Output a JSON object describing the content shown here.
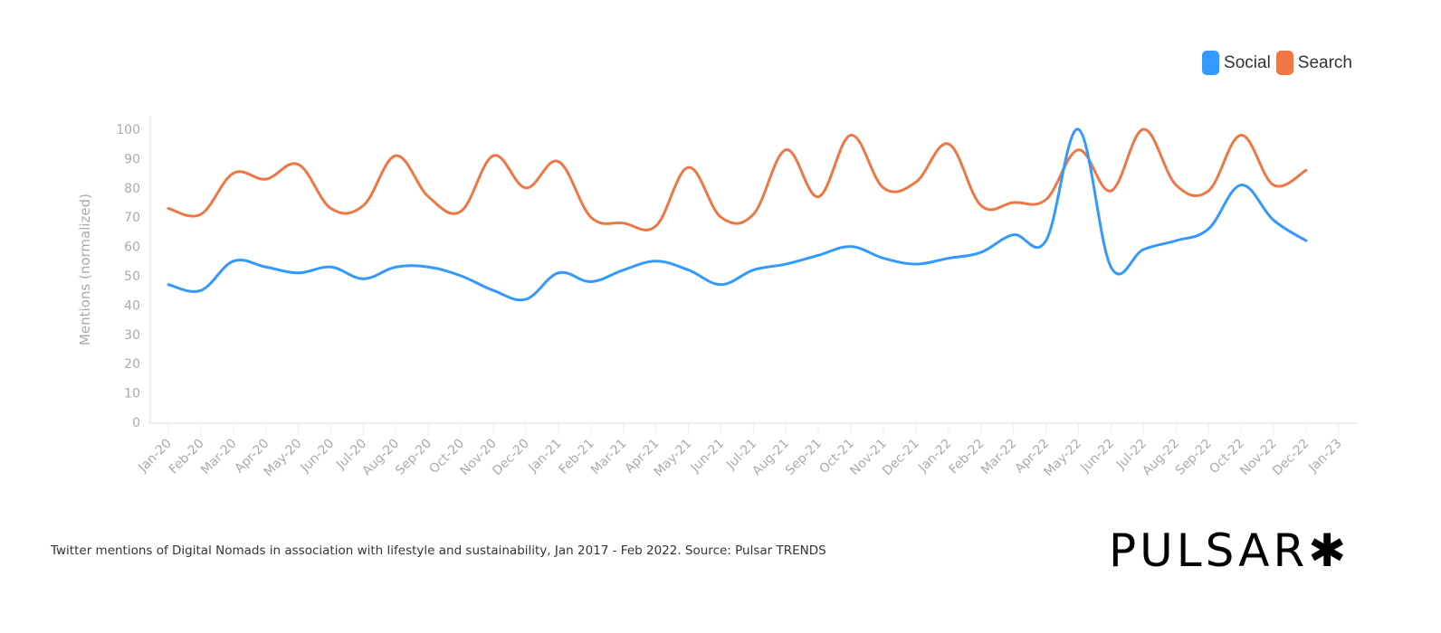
{
  "chart_data": {
    "type": "line",
    "title": "",
    "xlabel": "",
    "ylabel": "Mentions (normalized)",
    "ylim": [
      0,
      100
    ],
    "yticks": [
      0,
      10,
      20,
      30,
      40,
      50,
      60,
      70,
      80,
      90,
      100
    ],
    "grid": false,
    "legend_position": "top-right",
    "x": [
      "Jan-20",
      "Feb-20",
      "Mar-20",
      "Apr-20",
      "May-20",
      "Jun-20",
      "Jul-20",
      "Aug-20",
      "Sep-20",
      "Oct-20",
      "Nov-20",
      "Dec-20",
      "Jan-21",
      "Feb-21",
      "Mar-21",
      "Apr-21",
      "May-21",
      "Jun-21",
      "Jul-21",
      "Aug-21",
      "Sep-21",
      "Oct-21",
      "Nov-21",
      "Dec-21",
      "Jan-22",
      "Feb-22",
      "Mar-22",
      "Apr-22",
      "May-22",
      "Jun-22",
      "Jul-22",
      "Aug-22",
      "Sep-22",
      "Oct-22",
      "Nov-22",
      "Dec-22",
      "Jan-23"
    ],
    "series": [
      {
        "name": "Social",
        "color": "#3399ff",
        "values": [
          47,
          45,
          55,
          53,
          51,
          53,
          49,
          53,
          53,
          50,
          45,
          42,
          51,
          48,
          52,
          55,
          52,
          47,
          52,
          54,
          57,
          60,
          56,
          54,
          56,
          58,
          64,
          62,
          100,
          53,
          59,
          62,
          66,
          81,
          69,
          62
        ]
      },
      {
        "name": "Search",
        "color": "#ee7744",
        "values": [
          73,
          71,
          85,
          83,
          88,
          73,
          74,
          91,
          77,
          72,
          91,
          80,
          89,
          70,
          68,
          67,
          87,
          70,
          71,
          93,
          77,
          98,
          80,
          82,
          95,
          74,
          75,
          76,
          93,
          79,
          100,
          81,
          79,
          98,
          81,
          86
        ]
      }
    ]
  },
  "legend": {
    "items": [
      {
        "label": "Social",
        "color": "#3399ff"
      },
      {
        "label": "Search",
        "color": "#ee7744"
      }
    ]
  },
  "caption": "Twitter mentions of Digital Nomads in association with lifestyle and sustainability, Jan 2017 - Feb 2022. Source: Pulsar TRENDS",
  "logo": {
    "text": "PULSAR",
    "mark": "✱"
  }
}
